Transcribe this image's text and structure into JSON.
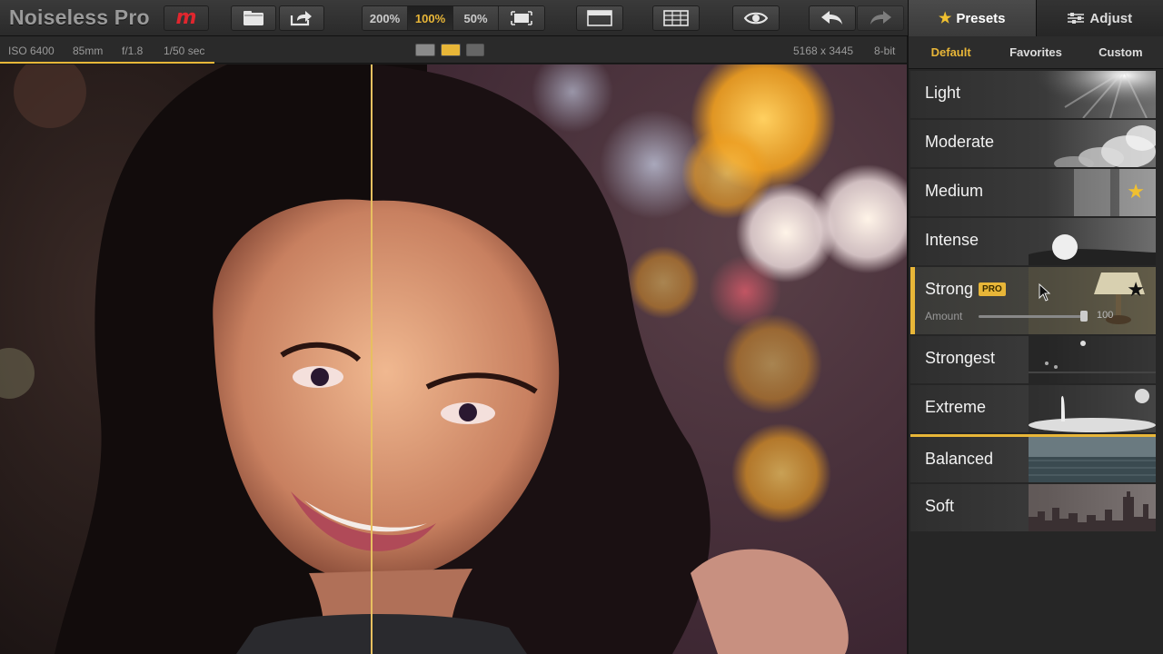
{
  "app": {
    "title": "Noiseless Pro"
  },
  "toolbar": {
    "zoom_options": [
      "200%",
      "100%",
      "50%"
    ],
    "zoom_active": "100%",
    "right_tabs": {
      "presets": "Presets",
      "adjust": "Adjust",
      "active": "presets"
    },
    "icons": [
      "macphun-logo-icon",
      "open-file-icon",
      "share-icon",
      "fit-screen-icon",
      "single-view-icon",
      "split-view-icon",
      "preview-eye-icon",
      "undo-icon",
      "redo-icon",
      "star-icon",
      "sliders-icon"
    ]
  },
  "infobar": {
    "iso": "ISO 6400",
    "focal": "85mm",
    "aperture": "f/1.8",
    "shutter": "1/50 sec",
    "dimensions": "5168 x 3445",
    "bitdepth": "8-bit",
    "view_modes": [
      "single",
      "split",
      "side-by-side"
    ],
    "view_mode_active": "split"
  },
  "panel": {
    "subtabs": [
      "Default",
      "Favorites",
      "Custom"
    ],
    "subtab_active": "Default",
    "presets": [
      {
        "name": "Light",
        "favorite": null
      },
      {
        "name": "Moderate",
        "favorite": null
      },
      {
        "name": "Medium",
        "favorite": "gold"
      },
      {
        "name": "Intense",
        "favorite": null
      },
      {
        "name": "Strong",
        "pro": "PRO",
        "favorite": "dark",
        "selected": true,
        "amount_label": "Amount",
        "amount_value": "100",
        "amount": 1.0
      },
      {
        "name": "Strongest",
        "favorite": null
      },
      {
        "name": "Extreme",
        "favorite": null
      },
      {
        "name": "Balanced",
        "favorite": null
      },
      {
        "name": "Soft",
        "favorite": null
      }
    ]
  },
  "colors": {
    "accent": "#e8b638",
    "brand_red": "#e0262e"
  }
}
